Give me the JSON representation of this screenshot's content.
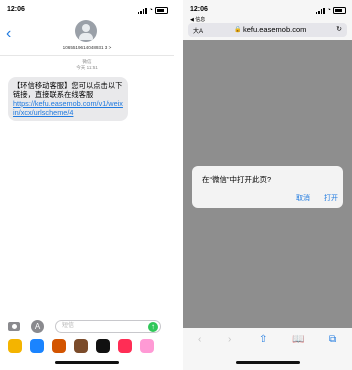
{
  "left": {
    "status": {
      "time": "12:06"
    },
    "back_glyph": "‹",
    "sender": "1065519614048931 3  >",
    "meta": {
      "service": "微信",
      "time": "今天 11:51"
    },
    "message": {
      "text": "【环信移动客服】您可以点击以下链接，直接联系在线客服",
      "link": "https://kefu.easemob.com/v1/weixin/xcx/urlscheme/4"
    },
    "compose": {
      "placeholder": "短信",
      "send_glyph": "↑",
      "apps_glyph": "A"
    },
    "app_strip": [
      {
        "name": "photos-app-icon",
        "color": "#f4b400"
      },
      {
        "name": "app-store-icon",
        "color": "#1a84ff"
      },
      {
        "name": "memoji-icon-1",
        "color": "#d35400"
      },
      {
        "name": "memoji-icon-2",
        "color": "#7b4b2a"
      },
      {
        "name": "record-icon",
        "color": "#111111"
      },
      {
        "name": "music-icon",
        "color": "#ff2d55"
      },
      {
        "name": "more-app-icon",
        "color": "#ff9ad5"
      }
    ]
  },
  "right": {
    "status": {
      "time": "12:06"
    },
    "back_to_app": "◀ 信息",
    "url_bar": {
      "aa": "大A",
      "lock": "🔒",
      "domain": "kefu.easemob.com",
      "reload": "↻"
    },
    "dialog": {
      "title": "在“微信”中打开此页?",
      "cancel": "取消",
      "open": "打开"
    },
    "toolbar": {
      "back": "‹",
      "forward": "›",
      "share": "⇧",
      "bookmarks": "📖",
      "tabs": "⧉"
    }
  }
}
